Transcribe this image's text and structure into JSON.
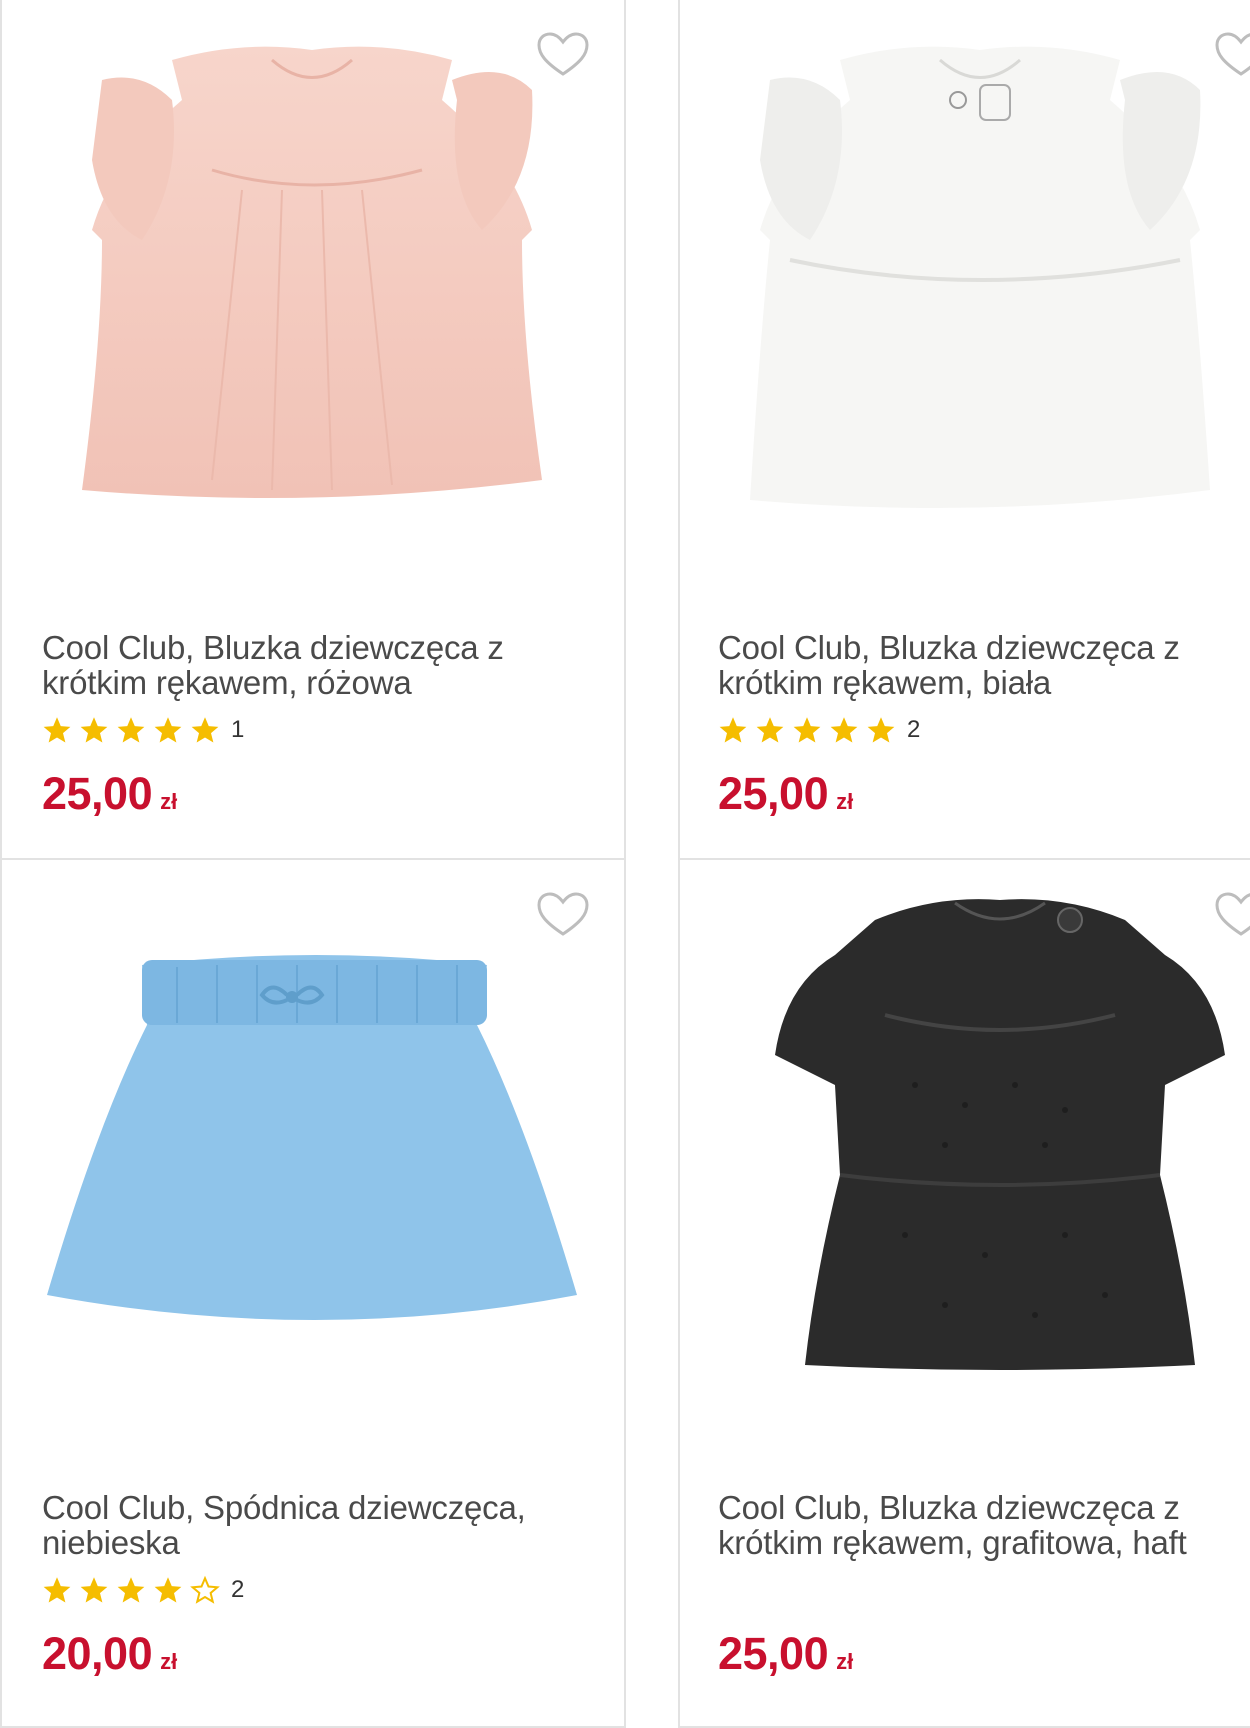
{
  "colors": {
    "price": "#c8102e",
    "star": "#f5bd00",
    "border": "#e2e2e2"
  },
  "products": [
    {
      "title_line1": "Cool Club, Bluzka dziewczęca z",
      "title_line2": "krótkim rękawem, różowa",
      "stars": 5,
      "rating_count": "1",
      "price": "25,00",
      "currency": "zł",
      "image": "pink-blouse"
    },
    {
      "title_line1": "Cool Club, Bluzka dziewczęca z",
      "title_line2": "krótkim rękawem, biała",
      "stars": 5,
      "rating_count": "2",
      "price": "25,00",
      "currency": "zł",
      "image": "white-blouse"
    },
    {
      "title_line1": "Cool Club, Spódnica dziewczęca,",
      "title_line2": "niebieska",
      "stars": 4,
      "rating_count": "2",
      "price": "20,00",
      "currency": "zł",
      "image": "blue-skirt"
    },
    {
      "title_line1": "Cool Club, Bluzka dziewczęca z",
      "title_line2": "krótkim rękawem, grafitowa, haft",
      "stars": 0,
      "rating_count": "",
      "price": "25,00",
      "currency": "zł",
      "image": "black-blouse"
    }
  ],
  "icons": {
    "favorite": "heart-outline-icon",
    "star_full": "star-filled-icon",
    "star_empty": "star-outline-icon"
  }
}
